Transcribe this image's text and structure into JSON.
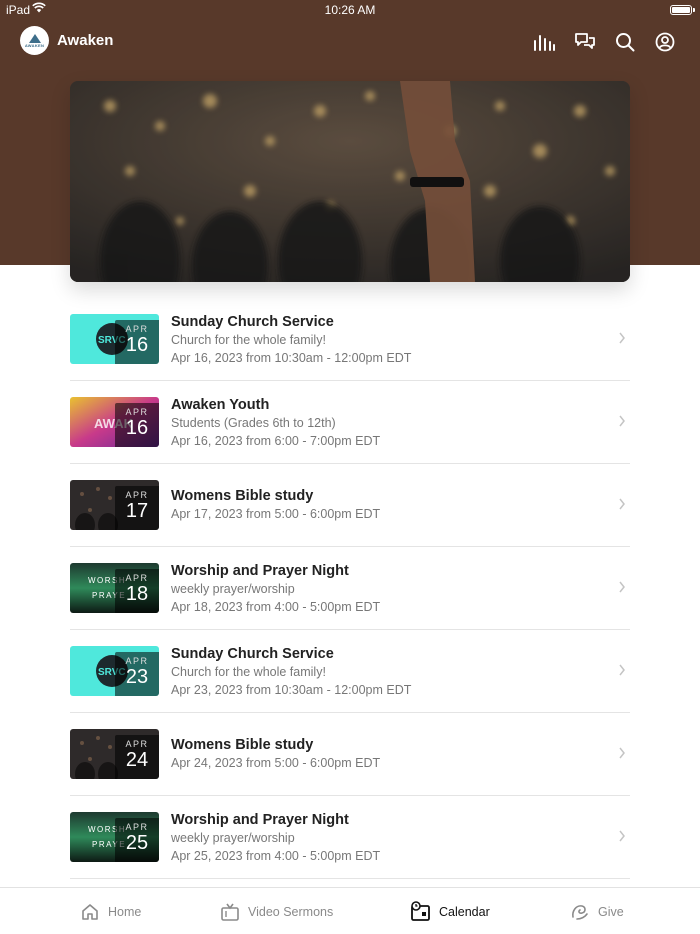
{
  "status_bar": {
    "device": "iPad",
    "time": "10:26 AM"
  },
  "app": {
    "title": "Awaken",
    "logo_text": "AWAKEN"
  },
  "header_icons": [
    "bars-chart-icon",
    "chat-bubbles-icon",
    "search-icon",
    "account-icon"
  ],
  "events": [
    {
      "title": "Sunday Church Service",
      "subtitle": "Church for the whole family!",
      "when": "Apr 16, 2023 from 10:30am - 12:00pm EDT",
      "month": "APR",
      "day": "16"
    },
    {
      "title": "Awaken Youth",
      "subtitle": "Students (Grades 6th to 12th)",
      "when": "Apr 16, 2023 from 6:00 - 7:00pm EDT",
      "month": "APR",
      "day": "16"
    },
    {
      "title": "Womens Bible study",
      "subtitle": "",
      "when": "Apr 17, 2023 from 5:00 - 6:00pm EDT",
      "month": "APR",
      "day": "17"
    },
    {
      "title": "Worship and Prayer Night",
      "subtitle": "weekly prayer/worship",
      "when": "Apr 18, 2023 from 4:00 - 5:00pm EDT",
      "month": "APR",
      "day": "18"
    },
    {
      "title": "Sunday Church Service",
      "subtitle": "Church for the whole family!",
      "when": "Apr 23, 2023 from 10:30am - 12:00pm EDT",
      "month": "APR",
      "day": "23"
    },
    {
      "title": "Womens Bible study",
      "subtitle": "",
      "when": "Apr 24, 2023 from 5:00 - 6:00pm EDT",
      "month": "APR",
      "day": "24"
    },
    {
      "title": "Worship and Prayer Night",
      "subtitle": "weekly prayer/worship",
      "when": "Apr 25, 2023 from 4:00 - 5:00pm EDT",
      "month": "APR",
      "day": "25"
    }
  ],
  "tabs": [
    {
      "label": "Home",
      "icon": "home-icon",
      "active": false
    },
    {
      "label": "Video Sermons",
      "icon": "tv-icon",
      "active": false
    },
    {
      "label": "Calendar",
      "icon": "calendar-icon",
      "active": true
    },
    {
      "label": "Give",
      "icon": "give-icon",
      "active": false
    }
  ],
  "colors": {
    "header_brown": "#58392a",
    "accent_cyan": "#4fe8dc"
  }
}
